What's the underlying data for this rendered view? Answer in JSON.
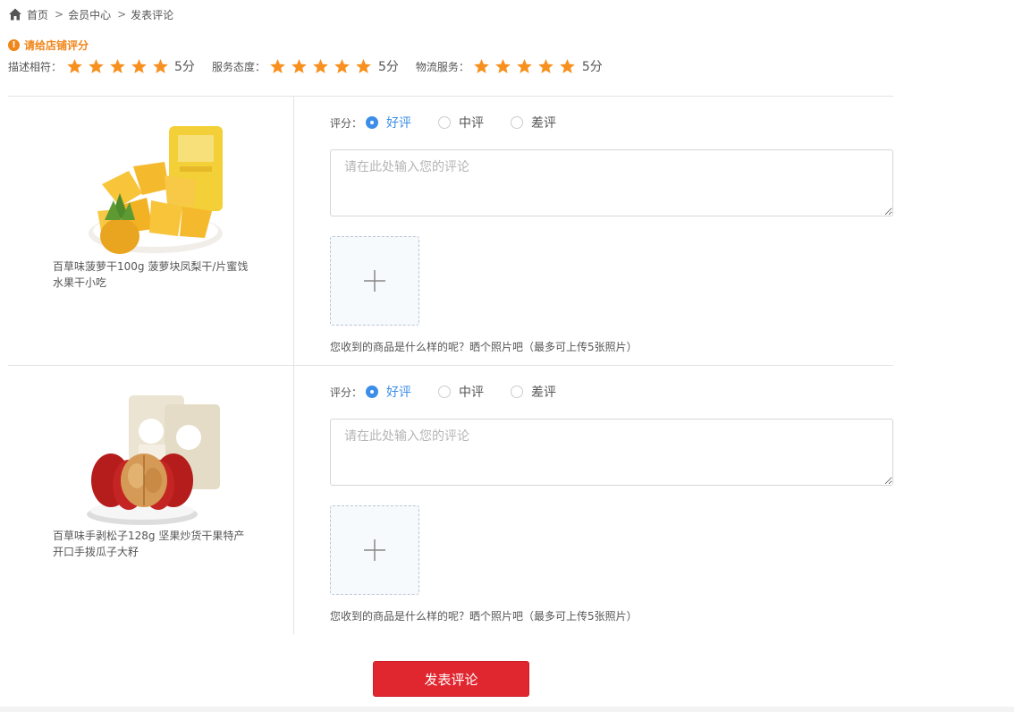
{
  "breadcrumb": {
    "icon": "home-icon",
    "items": [
      "首页",
      "会员中心",
      "发表评论"
    ],
    "separator": ">"
  },
  "shop_rating": {
    "title": "请给店铺评分",
    "icon": "warning-icon",
    "accent_color": "#f08519",
    "star_color": "#f7901e",
    "groups": [
      {
        "label": "描述相符：",
        "stars": 5,
        "score": "5分"
      },
      {
        "label": "服务态度：",
        "stars": 5,
        "score": "5分"
      },
      {
        "label": "物流服务：",
        "stars": 5,
        "score": "5分"
      }
    ]
  },
  "products": [
    {
      "name": "百草味菠萝干100g 菠萝块凤梨干/片蜜饯水果干小吃",
      "image": "dried-pineapple-image",
      "rating_label": "评分：",
      "options": [
        "好评",
        "中评",
        "差评"
      ],
      "selected": "好评",
      "comment_placeholder": "请在此处输入您的评论",
      "comment_value": "",
      "upload_icon": "plus-icon",
      "upload_hint": "您收到的商品是什么样的呢？晒个照片吧（最多可上传5张照片）"
    },
    {
      "name": "百草味手剥松子128g 坚果炒货干果特产开口手拨瓜子大籽",
      "image": "walnut-jujube-image",
      "rating_label": "评分：",
      "options": [
        "好评",
        "中评",
        "差评"
      ],
      "selected": "好评",
      "comment_placeholder": "请在此处输入您的评论",
      "comment_value": "",
      "upload_icon": "plus-icon",
      "upload_hint": "您收到的商品是什么样的呢？晒个照片吧（最多可上传5张照片）"
    }
  ],
  "submit": {
    "label": "发表评论",
    "color": "#e0262f"
  },
  "selected_color": "#3c8ee8"
}
